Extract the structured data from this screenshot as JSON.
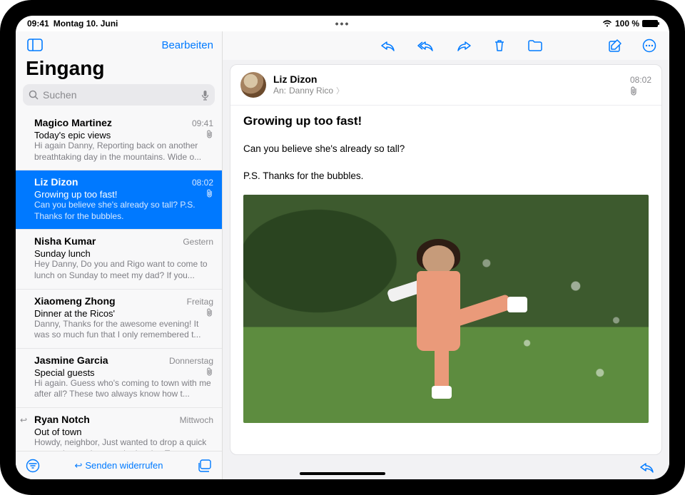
{
  "status": {
    "time": "09:41",
    "date": "Montag 10. Juni",
    "battery_pct": "100 %",
    "dots": "•••"
  },
  "accent": "#007aff",
  "sidebar": {
    "edit_label": "Bearbeiten",
    "title": "Eingang",
    "search_placeholder": "Suchen",
    "undo_label": "Senden widerrufen"
  },
  "messages": [
    {
      "sender": "Magico Martinez",
      "time": "09:41",
      "subject": "Today's epic views",
      "preview": "Hi again Danny, Reporting back on another breathtaking day in the mountains. Wide o...",
      "attachment": true,
      "selected": false
    },
    {
      "sender": "Liz Dizon",
      "time": "08:02",
      "subject": "Growing up too fast!",
      "preview": "Can you believe she's already so tall? P.S. Thanks for the bubbles.",
      "attachment": true,
      "selected": true
    },
    {
      "sender": "Nisha Kumar",
      "time": "Gestern",
      "subject": "Sunday lunch",
      "preview": "Hey Danny, Do you and Rigo want to come to lunch on Sunday to meet my dad? If you...",
      "attachment": false,
      "selected": false
    },
    {
      "sender": "Xiaomeng Zhong",
      "time": "Freitag",
      "subject": "Dinner at the Ricos'",
      "preview": "Danny, Thanks for the awesome evening! It was so much fun that I only remembered t...",
      "attachment": true,
      "selected": false
    },
    {
      "sender": "Jasmine Garcia",
      "time": "Donnerstag",
      "subject": "Special guests",
      "preview": "Hi again. Guess who's coming to town with me after all? These two always know how t...",
      "attachment": true,
      "selected": false
    },
    {
      "sender": "Ryan Notch",
      "time": "Mittwoch",
      "subject": "Out of town",
      "preview": "Howdy, neighbor, Just wanted to drop a quick note to let you know we're leaving T...",
      "attachment": false,
      "selected": false,
      "replied": true
    }
  ],
  "mail": {
    "from": "Liz Dizon",
    "to_label": "An:",
    "to_name": "Danny Rico",
    "time": "08:02",
    "attachment": true,
    "subject": "Growing up too fast!",
    "body_line1": "Can you believe she's already so tall?",
    "body_line2": "P.S. Thanks for the bubbles."
  }
}
